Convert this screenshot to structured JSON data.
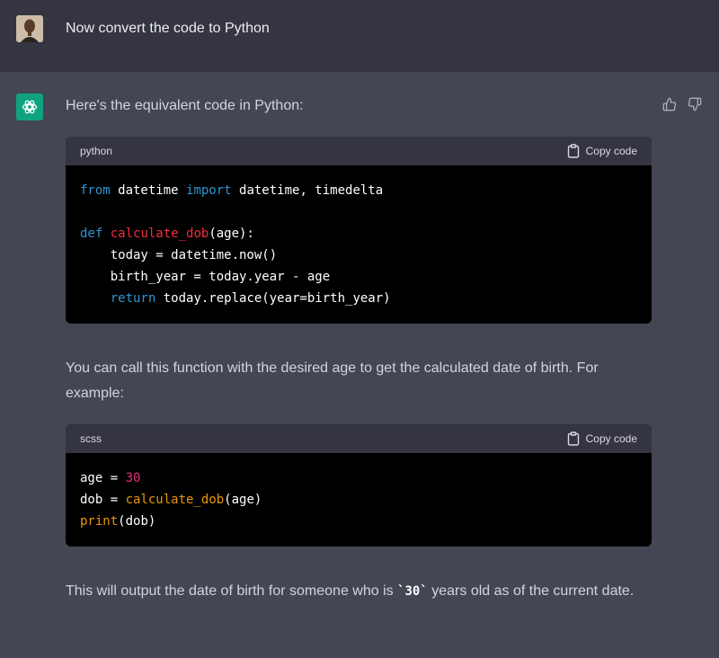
{
  "user_message": {
    "text": "Now convert the code to Python"
  },
  "assistant": {
    "intro": "Here's the equivalent code in Python:",
    "code_block_1": {
      "language": "python",
      "copy_label": "Copy code",
      "lines": [
        {
          "kw1": "from",
          "t1": " datetime ",
          "kw2": "import",
          "t2": " datetime, timedelta"
        },
        {
          "blank": ""
        },
        {
          "kw": "def",
          "sp": " ",
          "fn": "calculate_dob",
          "rest": "(age):"
        },
        {
          "text": "    today = datetime.now()"
        },
        {
          "text": "    birth_year = today.year - age"
        },
        {
          "indent": "    ",
          "kw": "return",
          "rest": " today.replace(year=birth_year)"
        }
      ]
    },
    "explanation": "You can call this function with the desired age to get the calculated date of birth. For example:",
    "code_block_2": {
      "language": "scss",
      "copy_label": "Copy code",
      "line1": {
        "a": "age = ",
        "num": "30"
      },
      "line2": {
        "a": "dob = ",
        "fn": "calculate_dob",
        "rest": "(age)"
      },
      "line3": {
        "fn": "print",
        "rest": "(dob)"
      }
    },
    "conclusion_pre": "This will output the date of birth for someone who is ",
    "conclusion_code": "`30`",
    "conclusion_post": " years old as of the current date."
  },
  "colors": {
    "background_user": "#343541",
    "background_assistant": "#444654",
    "brand_green": "#10a37f",
    "keyword": "#2e95d3",
    "function": "#f22c3d",
    "number": "#df3079",
    "builtin": "#e9950c"
  },
  "icons": {
    "user_avatar": "user-avatar",
    "assistant_avatar": "openai-logo-icon",
    "thumbs_up": "thumbs-up-icon",
    "thumbs_down": "thumbs-down-icon",
    "copy": "clipboard-icon"
  }
}
